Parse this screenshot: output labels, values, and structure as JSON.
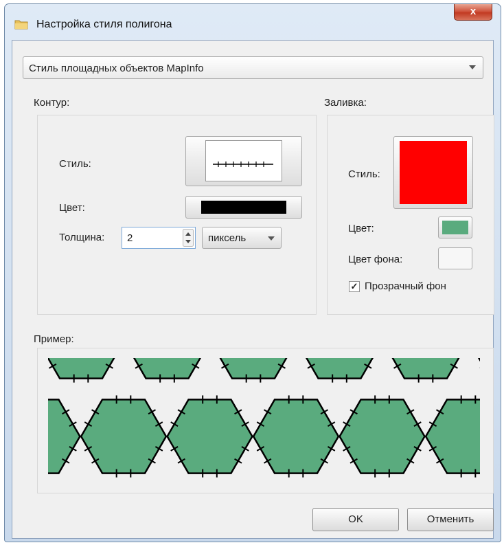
{
  "window": {
    "title": "Настройка стиля полигона",
    "close_glyph": "x"
  },
  "style_combo": {
    "value": "Стиль площадных объектов MapInfo"
  },
  "outline": {
    "heading": "Контур:",
    "style_label": "Стиль:",
    "color_label": "Цвет:",
    "color": "#000000",
    "width_label": "Толщина:",
    "width_value": "2",
    "unit_value": "пиксель"
  },
  "fill": {
    "heading": "Заливка:",
    "style_label": "Стиль:",
    "style_color": "#ff0000",
    "color_label": "Цвет:",
    "color": "#5aab7e",
    "bg_label": "Цвет фона:",
    "bg_color": "#f7f7f7",
    "transparent_checked": true,
    "transparent_label": "Прозрачный фон"
  },
  "preview": {
    "heading": "Пример:"
  },
  "buttons": {
    "ok": "OK",
    "cancel": "Отменить"
  }
}
